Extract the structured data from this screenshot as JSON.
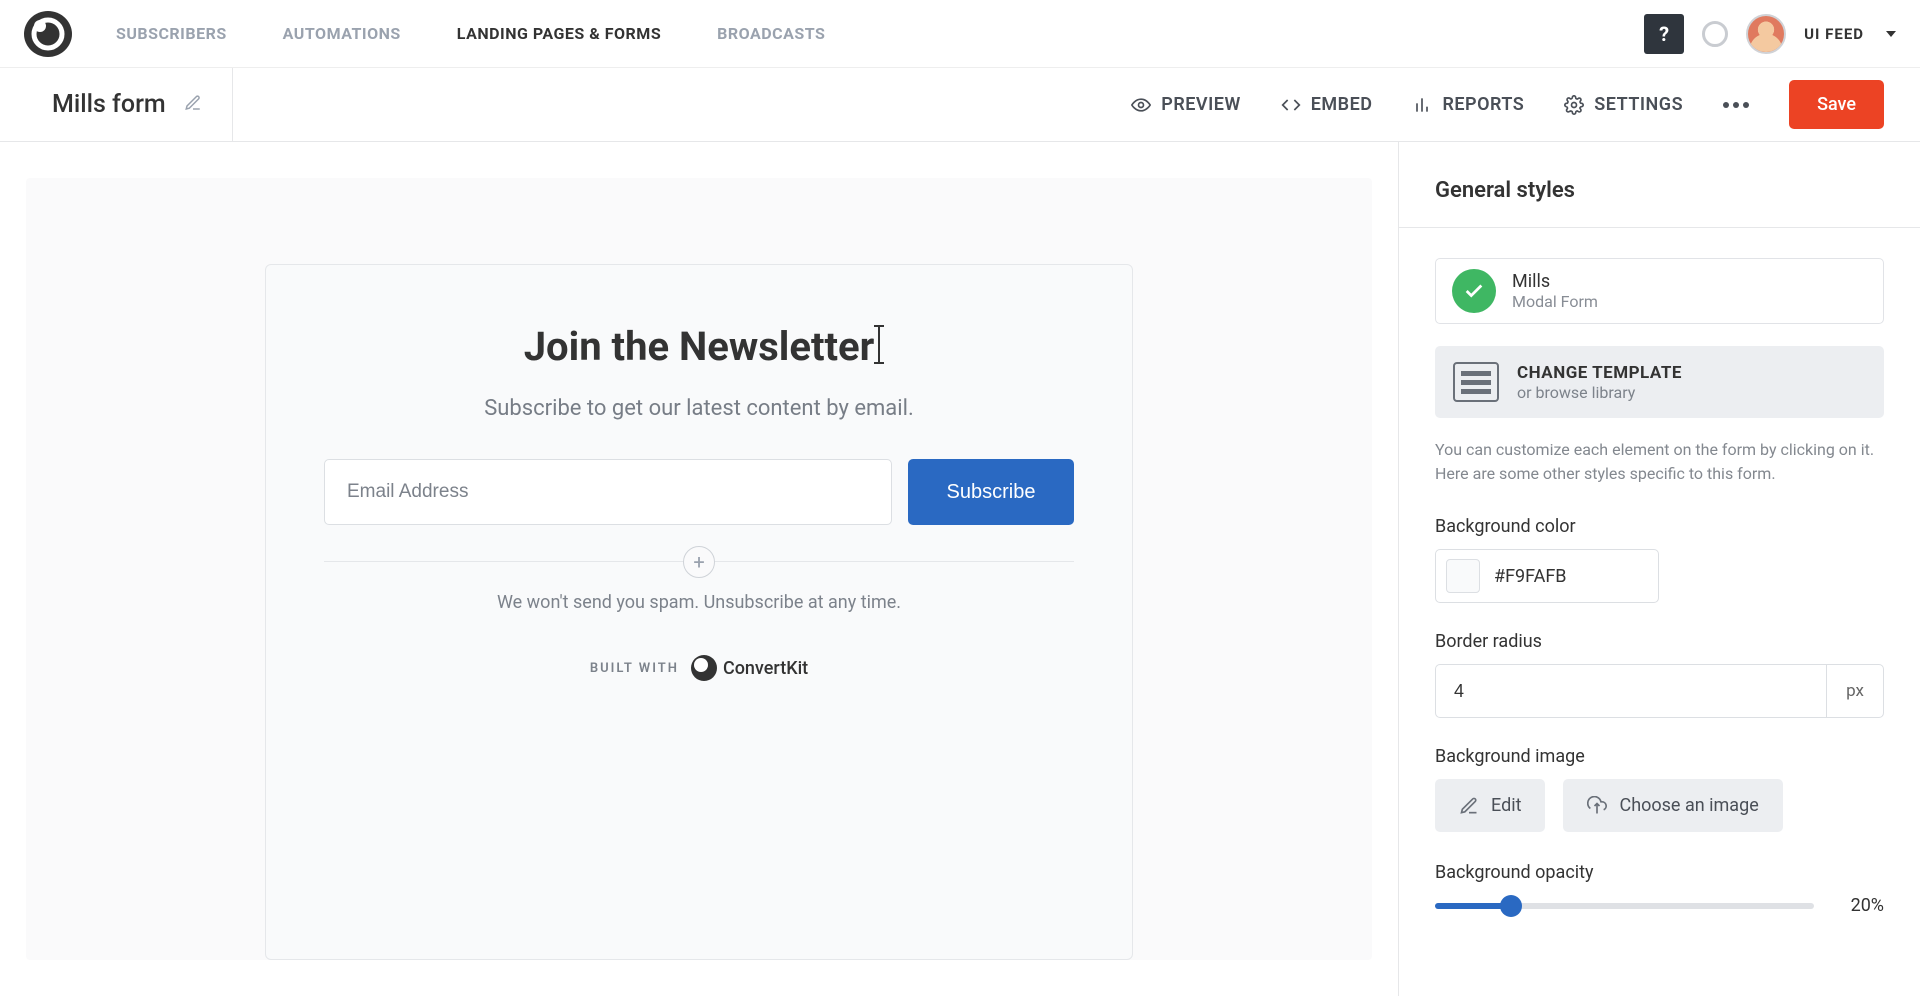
{
  "nav": {
    "links": [
      "SUBSCRIBERS",
      "AUTOMATIONS",
      "LANDING PAGES & FORMS",
      "BROADCASTS"
    ],
    "active_index": 2,
    "help_glyph": "?",
    "user_label": "UI FEED"
  },
  "subheader": {
    "form_name": "Mills form",
    "actions": {
      "preview": "PREVIEW",
      "embed": "EMBED",
      "reports": "REPORTS",
      "settings": "SETTINGS"
    },
    "save": "Save"
  },
  "canvas": {
    "title": "Join the Newsletter",
    "subtitle": "Subscribe to get our latest content by email.",
    "email_placeholder": "Email Address",
    "subscribe_label": "Subscribe",
    "footer": "We won't send you spam. Unsubscribe at any time.",
    "built_with": "BUILT WITH",
    "brand": "ConvertKit"
  },
  "sidepanel": {
    "title": "General styles",
    "template": {
      "name": "Mills",
      "type": "Modal Form"
    },
    "change_template": {
      "title": "CHANGE TEMPLATE",
      "sub": "or browse library"
    },
    "helper": "You can customize each element on the form by clicking on it. Here are some other styles specific to this form.",
    "bg_color": {
      "label": "Background color",
      "value": "#F9FAFB"
    },
    "border_radius": {
      "label": "Border radius",
      "value": "4",
      "unit": "px"
    },
    "bg_image": {
      "label": "Background image",
      "edit": "Edit",
      "choose": "Choose an image"
    },
    "bg_opacity": {
      "label": "Background opacity",
      "value": 20,
      "display": "20%"
    }
  }
}
